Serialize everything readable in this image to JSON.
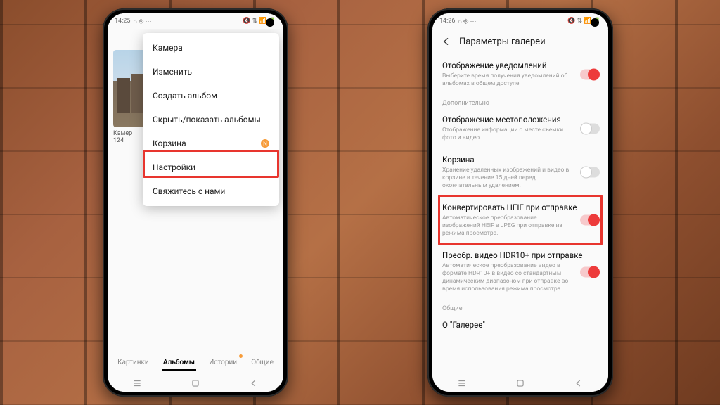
{
  "phone1": {
    "statusbar": {
      "time": "14:25",
      "left_icons": "⌂ ⎆ ⋯",
      "right_icons": "🔇 ⇅ 📶 🔋"
    },
    "thumb_label": "Камер",
    "thumb_count": "124",
    "menu": [
      {
        "label": "Камера"
      },
      {
        "label": "Изменить"
      },
      {
        "label": "Создать альбом"
      },
      {
        "label": "Скрыть/показать альбомы"
      },
      {
        "label": "Корзина",
        "badge": "N"
      },
      {
        "label": "Настройки"
      },
      {
        "label": "Свяжитесь с нами"
      }
    ],
    "tabs": [
      {
        "label": "Картинки"
      },
      {
        "label": "Альбомы",
        "active": true
      },
      {
        "label": "Истории",
        "dot": true
      },
      {
        "label": "Общие"
      }
    ]
  },
  "phone2": {
    "statusbar": {
      "time": "14:26",
      "left_icons": "⌂ ⎆ ⋯",
      "right_icons": "🔇 ⇅ 📶 🔋"
    },
    "header": "Параметры галереи",
    "rows": [
      {
        "title": "Отображение уведомлений",
        "sub": "Выберите время получения уведомлений об альбомах в общем доступе.",
        "toggle": "on"
      },
      {
        "section": "Дополнительно"
      },
      {
        "title": "Отображение местоположения",
        "sub": "Отображение информации о месте съемки фото и видео.",
        "toggle": "off"
      },
      {
        "title": "Корзина",
        "sub": "Хранение удаленных изображений и видео в корзине в течение 15 дней перед окончательным удалением.",
        "toggle": "off"
      },
      {
        "title": "Конвертировать HEIF при отправке",
        "sub": "Автоматическое преобразование изображений HEIF в JPEG при отправке из режима просмотра.",
        "toggle": "on",
        "hl": true
      },
      {
        "title": "Преобр. видео HDR10+ при отправке",
        "sub": "Автоматическое преобразование видео в формате HDR10+ в видео со стандартным динамическим диапазоном при отправке во время использования режима просмотра.",
        "toggle": "on"
      },
      {
        "section": "Общие"
      },
      {
        "title": "О \"Галерее\""
      }
    ]
  }
}
